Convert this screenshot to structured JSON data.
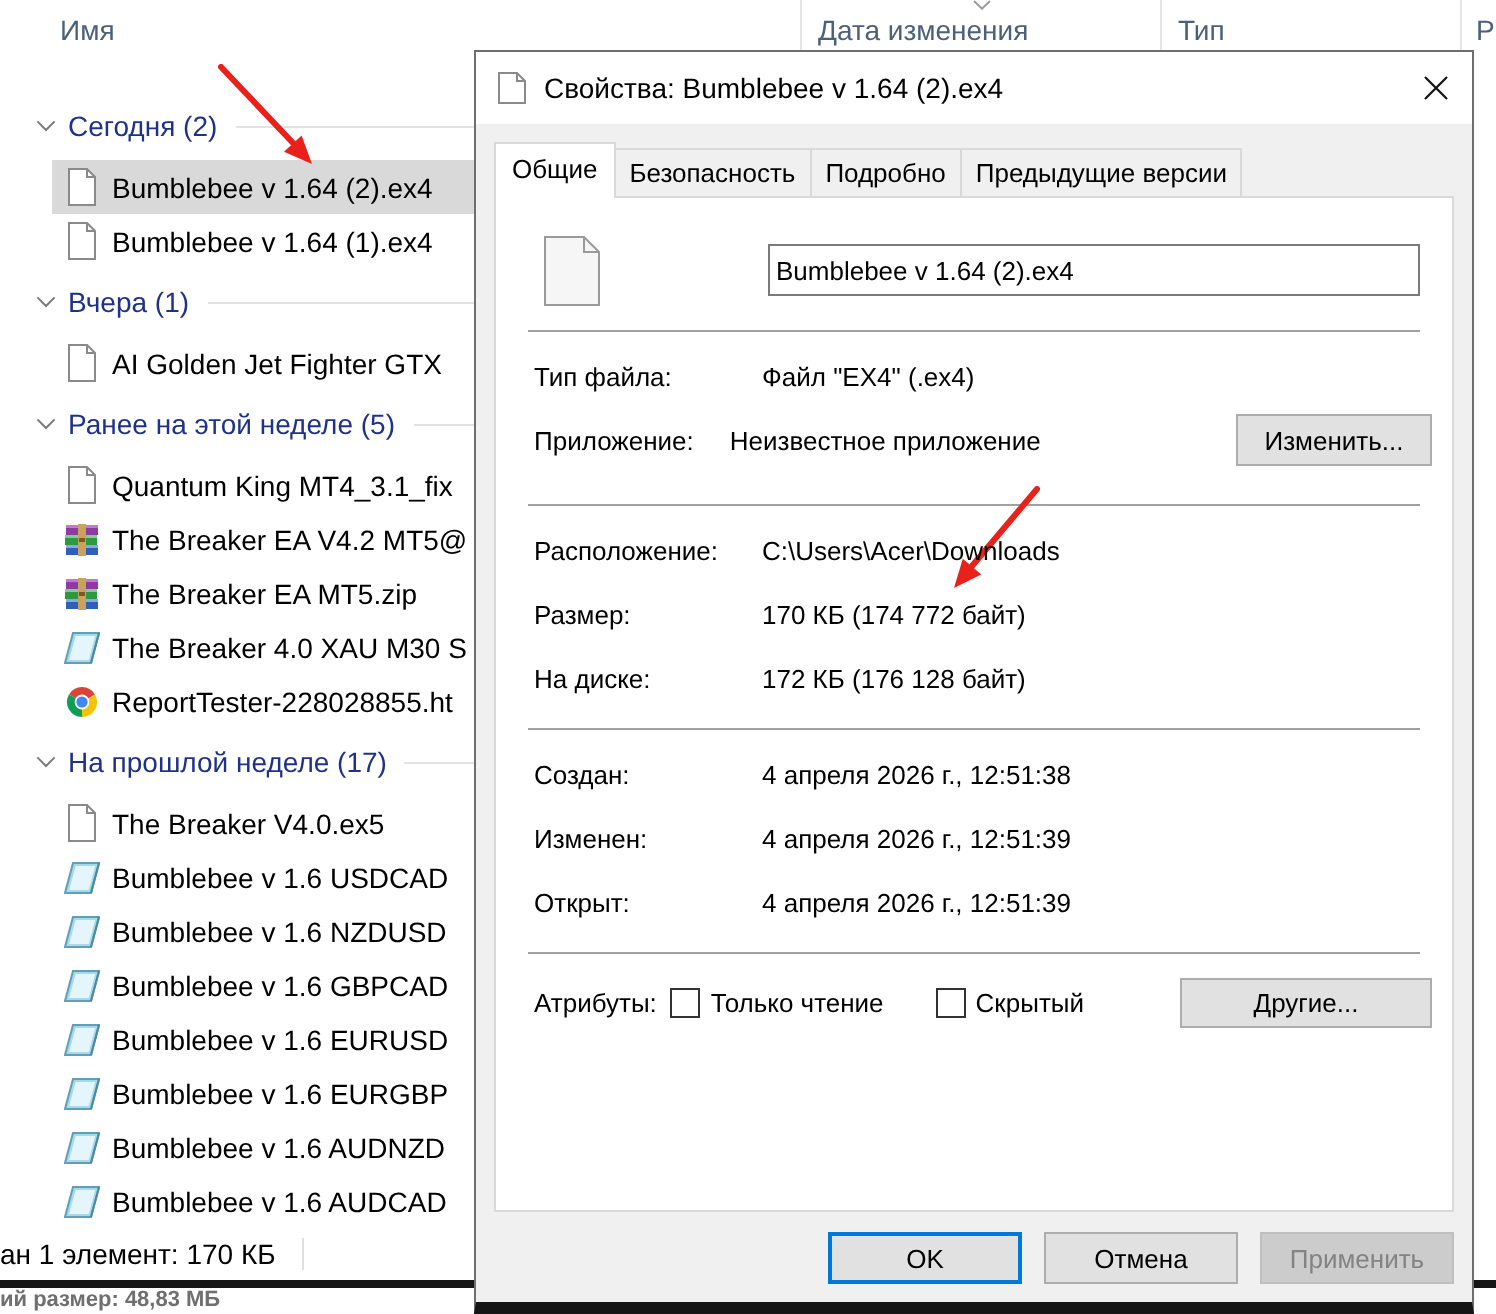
{
  "explorer": {
    "columns": [
      {
        "label": "Имя",
        "sorted": false
      },
      {
        "label": "Дата изменения",
        "sorted": true
      },
      {
        "label": "Тип",
        "sorted": false
      },
      {
        "label": "Р",
        "sorted": false
      }
    ],
    "groups": [
      {
        "label": "Сегодня (2)",
        "expanded": true,
        "items": [
          {
            "kind": "document",
            "name": "Bumblebee v 1.64 (2).ex4",
            "selected": true
          },
          {
            "kind": "document",
            "name": "Bumblebee v 1.64 (1).ex4",
            "selected": false
          }
        ]
      },
      {
        "label": "Вчера (1)",
        "expanded": true,
        "items": [
          {
            "kind": "document",
            "name": "AI Golden Jet Fighter GTX",
            "selected": false
          }
        ]
      },
      {
        "label": "Ранее на этой неделе (5)",
        "expanded": true,
        "items": [
          {
            "kind": "document",
            "name": "Quantum King MT4_3.1_fix",
            "selected": false
          },
          {
            "kind": "archive",
            "name": "The Breaker EA V4.2 MT5@",
            "selected": false
          },
          {
            "kind": "archive",
            "name": "The Breaker EA MT5.zip",
            "selected": false
          },
          {
            "kind": "preset",
            "name": "The Breaker 4.0 XAU M30 S",
            "selected": false
          },
          {
            "kind": "webpage",
            "name": "ReportTester-228028855.ht",
            "selected": false
          }
        ]
      },
      {
        "label": "На прошлой неделе (17)",
        "expanded": true,
        "items": [
          {
            "kind": "document",
            "name": "The Breaker V4.0.ex5",
            "selected": false
          },
          {
            "kind": "preset",
            "name": "Bumblebee v 1.6 USDCAD",
            "selected": false
          },
          {
            "kind": "preset",
            "name": "Bumblebee v 1.6 NZDUSD",
            "selected": false
          },
          {
            "kind": "preset",
            "name": "Bumblebee v 1.6 GBPCAD",
            "selected": false
          },
          {
            "kind": "preset",
            "name": "Bumblebee v 1.6 EURUSD",
            "selected": false
          },
          {
            "kind": "preset",
            "name": "Bumblebee v 1.6 EURGBP",
            "selected": false
          },
          {
            "kind": "preset",
            "name": "Bumblebee v 1.6 AUDNZD",
            "selected": false
          },
          {
            "kind": "preset",
            "name": "Bumblebee v 1.6 AUDCAD",
            "selected": false
          }
        ]
      }
    ],
    "status_bar": "ан 1 элемент: 170 КБ"
  },
  "background_window": {
    "text": "ий размер: 48,83 МБ"
  },
  "dialog": {
    "title": "Свойства: Bumblebee v 1.64 (2).ex4",
    "tabs": [
      {
        "label": "Общие",
        "selected": true
      },
      {
        "label": "Безопасность",
        "selected": false
      },
      {
        "label": "Подробно",
        "selected": false
      },
      {
        "label": "Предыдущие версии",
        "selected": false
      }
    ],
    "file_name": "Bumblebee v 1.64 (2).ex4",
    "sections": [
      [
        {
          "label": "Тип файла:",
          "value": "Файл \"EX4\" (.ex4)"
        },
        {
          "label": "Приложение:",
          "value": "Неизвестное приложение",
          "button": "Изменить..."
        }
      ],
      [
        {
          "label": "Расположение:",
          "value": "C:\\Users\\Acer\\Downloads"
        },
        {
          "label": "Размер:",
          "value": "170 КБ (174 772 байт)"
        },
        {
          "label": "На диске:",
          "value": "172 КБ (176 128 байт)"
        }
      ],
      [
        {
          "label": "Создан:",
          "value": "4 апреля 2026 г., 12:51:38"
        },
        {
          "label": "Изменен:",
          "value": "4 апреля 2026 г., 12:51:39"
        },
        {
          "label": "Открыт:",
          "value": "4 апреля 2026 г., 12:51:39"
        }
      ]
    ],
    "attributes": {
      "label": "Атрибуты:",
      "checkboxes": [
        {
          "label": "Только чтение",
          "checked": false
        },
        {
          "label": "Скрытый",
          "checked": false
        }
      ],
      "button": "Другие..."
    },
    "buttons": [
      {
        "label": "OK",
        "default": true,
        "disabled": false
      },
      {
        "label": "Отмена",
        "default": false,
        "disabled": false
      },
      {
        "label": "Применить",
        "default": false,
        "disabled": true
      }
    ]
  }
}
